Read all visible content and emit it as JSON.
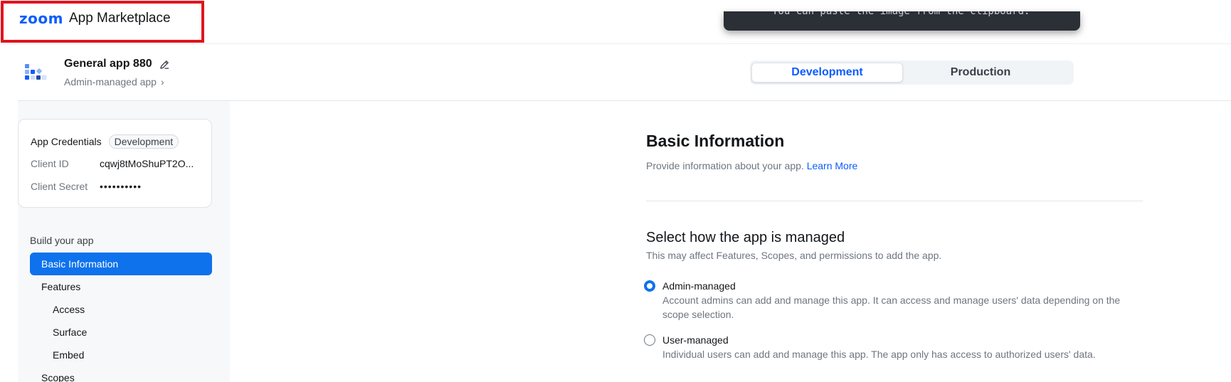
{
  "header": {
    "logo_brand": "zoom",
    "logo_text": "App Marketplace",
    "toast_text": "You can paste the image from the clipboard."
  },
  "app": {
    "name": "General app 880",
    "type": "Admin-managed app",
    "env_tabs": [
      {
        "label": "Development",
        "selected": true
      },
      {
        "label": "Production",
        "selected": false
      }
    ]
  },
  "sidebar": {
    "credentials": {
      "title": "App Credentials",
      "badge": "Development",
      "client_id_label": "Client ID",
      "client_id_value": "cqwj8tMoShuPT2O...",
      "client_secret_label": "Client Secret",
      "client_secret_value": "••••••••••"
    },
    "build_label": "Build your app",
    "nav": [
      {
        "label": "Basic Information",
        "active": true
      },
      {
        "label": "Features",
        "active": false
      },
      {
        "label": "Access",
        "active": false
      },
      {
        "label": "Surface",
        "active": false
      },
      {
        "label": "Embed",
        "active": false
      },
      {
        "label": "Scopes",
        "active": false
      }
    ]
  },
  "main": {
    "title": "Basic Information",
    "description": "Provide information about your app.",
    "learn_more": "Learn More",
    "section_title": "Select how the app is managed",
    "section_desc": "This may affect Features, Scopes, and permissions to add the app.",
    "options": [
      {
        "label": "Admin-managed",
        "selected": true,
        "desc": "Account admins can add and manage this app. It can access and manage users' data depending on the scope selection."
      },
      {
        "label": "User-managed",
        "selected": false,
        "desc": "Individual users can add and manage this app. The app only has access to authorized users' data."
      }
    ]
  },
  "colors": {
    "accent": "#0E72ED",
    "brand": "#0B5CFF",
    "highlight_box": "#E0141E"
  }
}
